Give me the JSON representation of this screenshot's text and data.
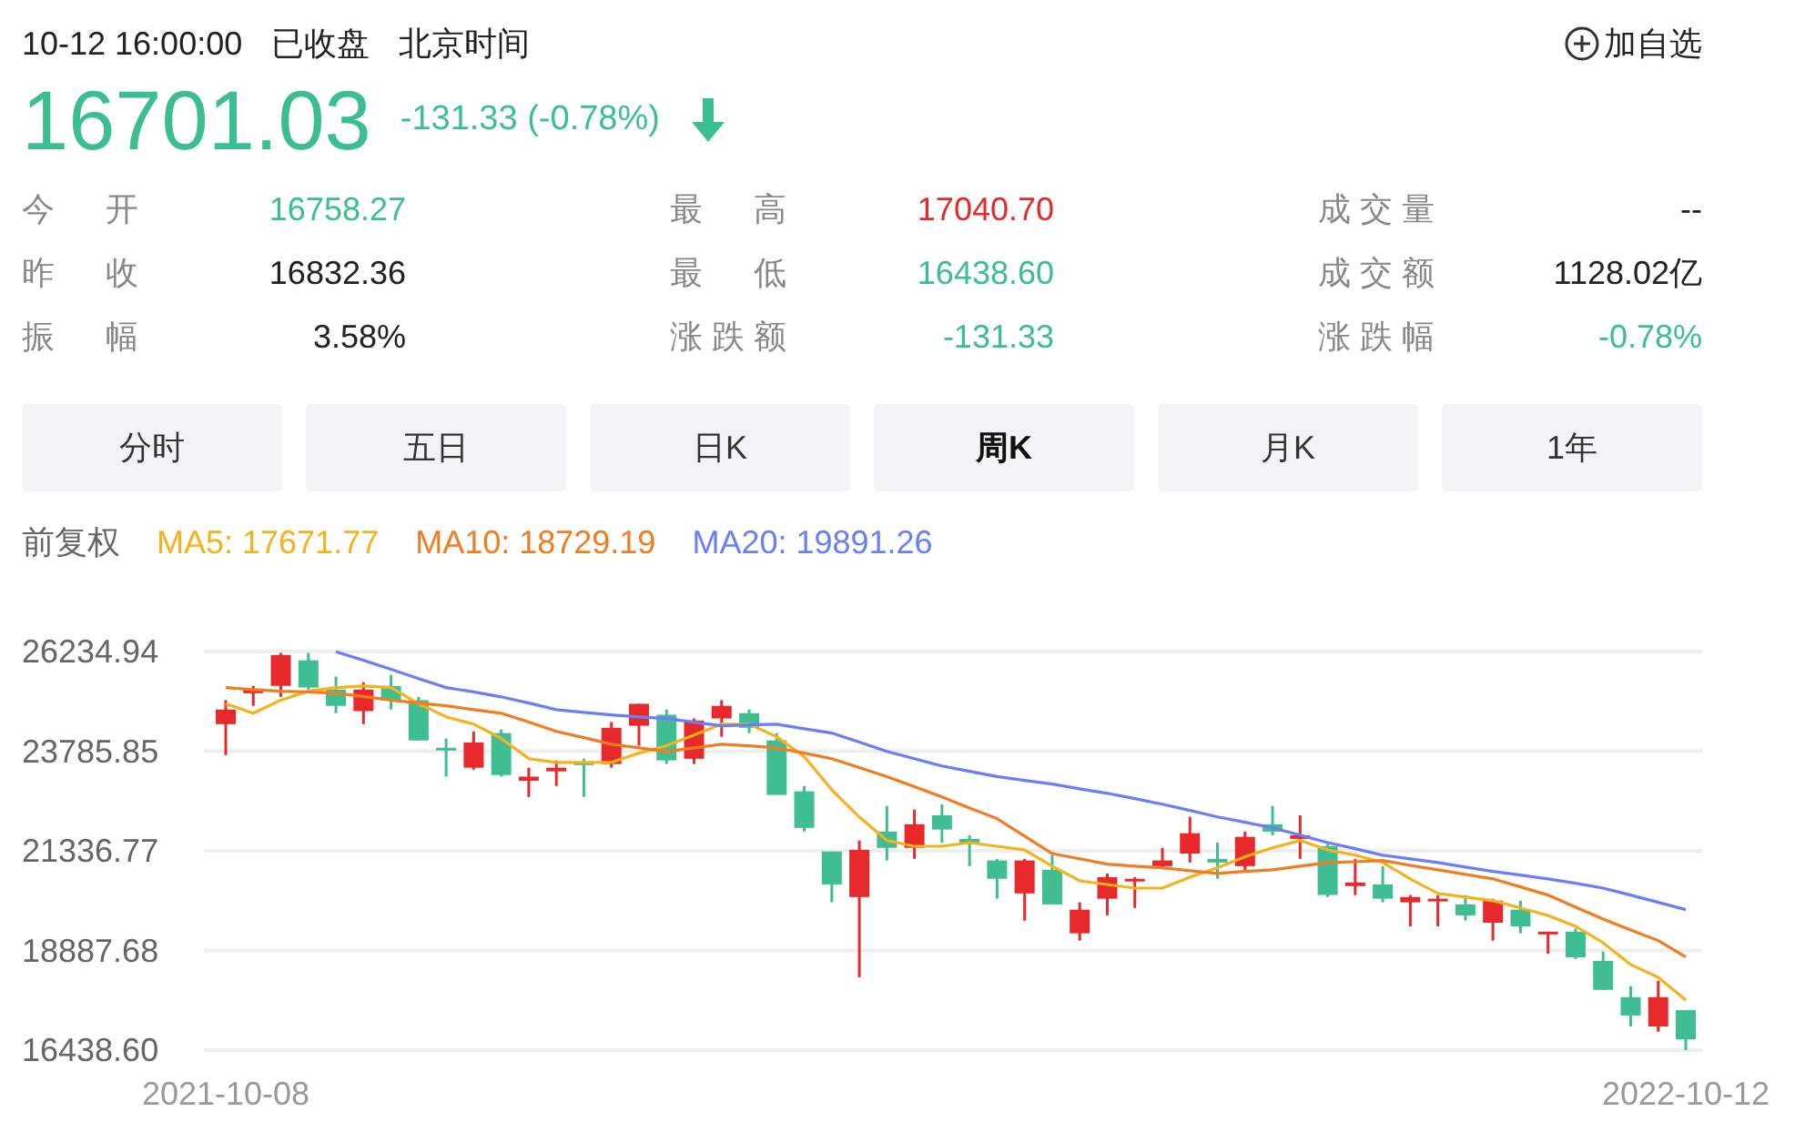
{
  "header": {
    "time": "10-12 16:00:00",
    "status": "已收盘",
    "timezone": "北京时间",
    "add_button": "加自选"
  },
  "quote": {
    "price": "16701.03",
    "change": "-131.33 (-0.78%)",
    "color": "#3bbf8f"
  },
  "stats": [
    {
      "label": "今开",
      "value": "16758.27",
      "color": "#3bbf8f"
    },
    {
      "label": "最高",
      "value": "17040.70",
      "color": "#e8292b"
    },
    {
      "label": "成交量",
      "value": "--",
      "color": "#222222"
    },
    {
      "label": "昨收",
      "value": "16832.36",
      "color": "#222222"
    },
    {
      "label": "最低",
      "value": "16438.60",
      "color": "#3bbf8f"
    },
    {
      "label": "成交额",
      "value": "1128.02亿",
      "color": "#222222"
    },
    {
      "label": "振幅",
      "value": "3.58%",
      "color": "#222222"
    },
    {
      "label": "涨跌额",
      "value": "-131.33",
      "color": "#3bbf8f"
    },
    {
      "label": "涨跌幅",
      "value": "-0.78%",
      "color": "#3bbf8f"
    }
  ],
  "tabs": [
    {
      "label": "分时",
      "selected": false
    },
    {
      "label": "五日",
      "selected": false
    },
    {
      "label": "日K",
      "selected": false
    },
    {
      "label": "周K",
      "selected": true
    },
    {
      "label": "月K",
      "selected": false
    },
    {
      "label": "1年",
      "selected": false
    }
  ],
  "legend": {
    "adjustment": "前复权",
    "values": [
      "17671.77",
      "18729.19",
      "19891.26"
    ]
  },
  "chart": {
    "chart_data": {
      "type": "candlestick",
      "grid": true,
      "ylim": [
        16438.6,
        26234.94
      ],
      "categories": [
        "2021-10-08",
        null,
        null,
        null,
        null,
        null,
        null,
        null,
        null,
        null,
        null,
        null,
        null,
        null,
        null,
        null,
        null,
        null,
        null,
        null,
        null,
        null,
        null,
        null,
        null,
        null,
        null,
        null,
        null,
        null,
        null,
        null,
        null,
        null,
        null,
        null,
        null,
        null,
        null,
        null,
        null,
        null,
        null,
        null,
        null,
        null,
        null,
        null,
        null,
        null,
        null,
        null,
        null,
        "2022-10-12"
      ],
      "yticks": [
        {
          "value": 26234.94,
          "label": "26234.94"
        },
        {
          "value": 23785.85,
          "label": "23785.85"
        },
        {
          "value": 21336.77,
          "label": "21336.77"
        },
        {
          "value": 18887.68,
          "label": "18887.68"
        },
        {
          "value": 16438.6,
          "label": "16438.60"
        }
      ],
      "ohlc": [
        [
          24450,
          25040,
          23690,
          24810
        ],
        [
          25210,
          25390,
          24900,
          25300
        ],
        [
          25390,
          26200,
          25120,
          26150
        ],
        [
          26020,
          26200,
          25300,
          25350
        ],
        [
          25300,
          25620,
          24720,
          24900
        ],
        [
          24770,
          25480,
          24450,
          25300
        ],
        [
          25390,
          25660,
          24810,
          25040
        ],
        [
          25040,
          25120,
          24050,
          24050
        ],
        [
          23870,
          24100,
          23160,
          23830
        ],
        [
          23380,
          24270,
          23330,
          24000
        ],
        [
          24230,
          24320,
          23160,
          23200
        ],
        [
          23060,
          23380,
          22660,
          23160
        ],
        [
          23290,
          23560,
          22930,
          23380
        ],
        [
          23510,
          23600,
          22660,
          23470
        ],
        [
          23470,
          24500,
          23380,
          24360
        ],
        [
          24410,
          24950,
          23920,
          24950
        ],
        [
          24680,
          24810,
          23470,
          23560
        ],
        [
          23600,
          24590,
          23470,
          24540
        ],
        [
          24590,
          25040,
          24140,
          24900
        ],
        [
          24720,
          24810,
          24230,
          24360
        ],
        [
          24050,
          24230,
          22710,
          22710
        ],
        [
          22800,
          22930,
          21810,
          21900
        ],
        [
          21320,
          21320,
          20070,
          20510
        ],
        [
          20200,
          21590,
          18230,
          21360
        ],
        [
          21810,
          22440,
          21100,
          21410
        ],
        [
          21410,
          22350,
          21140,
          21990
        ],
        [
          22210,
          22480,
          21540,
          21860
        ],
        [
          21630,
          21720,
          20960,
          21500
        ],
        [
          21100,
          21140,
          20160,
          20650
        ],
        [
          20290,
          21140,
          19620,
          21100
        ],
        [
          20870,
          21230,
          20020,
          20020
        ],
        [
          19310,
          20070,
          19130,
          19890
        ],
        [
          20160,
          20780,
          19750,
          20690
        ],
        [
          20600,
          20690,
          19930,
          20650
        ],
        [
          20960,
          21410,
          20920,
          21100
        ],
        [
          21270,
          22170,
          21050,
          21770
        ],
        [
          21140,
          21540,
          20650,
          21050
        ],
        [
          20960,
          21810,
          20830,
          21680
        ],
        [
          21990,
          22440,
          21720,
          21810
        ],
        [
          21630,
          22210,
          21140,
          21720
        ],
        [
          21450,
          21500,
          20200,
          20250
        ],
        [
          20470,
          21140,
          20250,
          20560
        ],
        [
          20510,
          20960,
          20070,
          20160
        ],
        [
          20070,
          20250,
          19480,
          20200
        ],
        [
          20110,
          20250,
          19480,
          20160
        ],
        [
          20020,
          20250,
          19620,
          19750
        ],
        [
          19570,
          20160,
          19130,
          20110
        ],
        [
          19890,
          20110,
          19310,
          19480
        ],
        [
          19310,
          19350,
          18810,
          19350
        ],
        [
          19350,
          19430,
          18680,
          18720
        ],
        [
          18630,
          18860,
          17920,
          17920
        ],
        [
          17740,
          18010,
          17020,
          17290
        ],
        [
          17020,
          18140,
          16890,
          17740
        ],
        [
          17420,
          17420,
          16439,
          16701
        ]
      ],
      "series": [
        {
          "name": "MA5:",
          "type": "line",
          "color": "#f5b21c",
          "values": [
            24950,
            24720,
            25040,
            25260,
            25350,
            25390,
            25350,
            24950,
            24630,
            24450,
            24100,
            23600,
            23510,
            23510,
            23510,
            23740,
            23920,
            24180,
            24450,
            24450,
            24140,
            23650,
            22840,
            22170,
            21590,
            21450,
            21450,
            21540,
            21450,
            21360,
            20960,
            20600,
            20510,
            20420,
            20420,
            20690,
            20920,
            21190,
            21410,
            21590,
            21360,
            21230,
            21050,
            20650,
            20290,
            20200,
            20110,
            19930,
            19750,
            19480,
            19080,
            18540,
            18230,
            17670
          ]
        },
        {
          "name": "MA10:",
          "type": "line",
          "color": "#f17c22",
          "values": [
            25350,
            25300,
            25260,
            25240,
            25210,
            25130,
            25040,
            24970,
            24900,
            24810,
            24720,
            24500,
            24270,
            24120,
            23960,
            23870,
            23780,
            23870,
            23960,
            23920,
            23870,
            23740,
            23600,
            23380,
            23160,
            22910,
            22660,
            22390,
            22130,
            21700,
            21270,
            21140,
            21010,
            20960,
            20920,
            20850,
            20780,
            20830,
            20870,
            20960,
            21050,
            21070,
            21100,
            20980,
            20870,
            20760,
            20650,
            20450,
            20250,
            19950,
            19660,
            19390,
            19130,
            18730
          ]
        },
        {
          "name": "MA20:",
          "type": "line",
          "color": "#6a7ef7",
          "values": [
            null,
            null,
            null,
            null,
            26230,
            26020,
            25800,
            25570,
            25350,
            25240,
            25120,
            24970,
            24810,
            24740,
            24680,
            24630,
            24590,
            24500,
            24410,
            24430,
            24450,
            24340,
            24230,
            24010,
            23780,
            23600,
            23420,
            23290,
            23160,
            23070,
            22980,
            22860,
            22750,
            22620,
            22480,
            22330,
            22170,
            22040,
            21900,
            21720,
            21540,
            21390,
            21230,
            21140,
            21050,
            20940,
            20830,
            20740,
            20650,
            20540,
            20420,
            20250,
            20070,
            19890
          ]
        }
      ]
    }
  }
}
